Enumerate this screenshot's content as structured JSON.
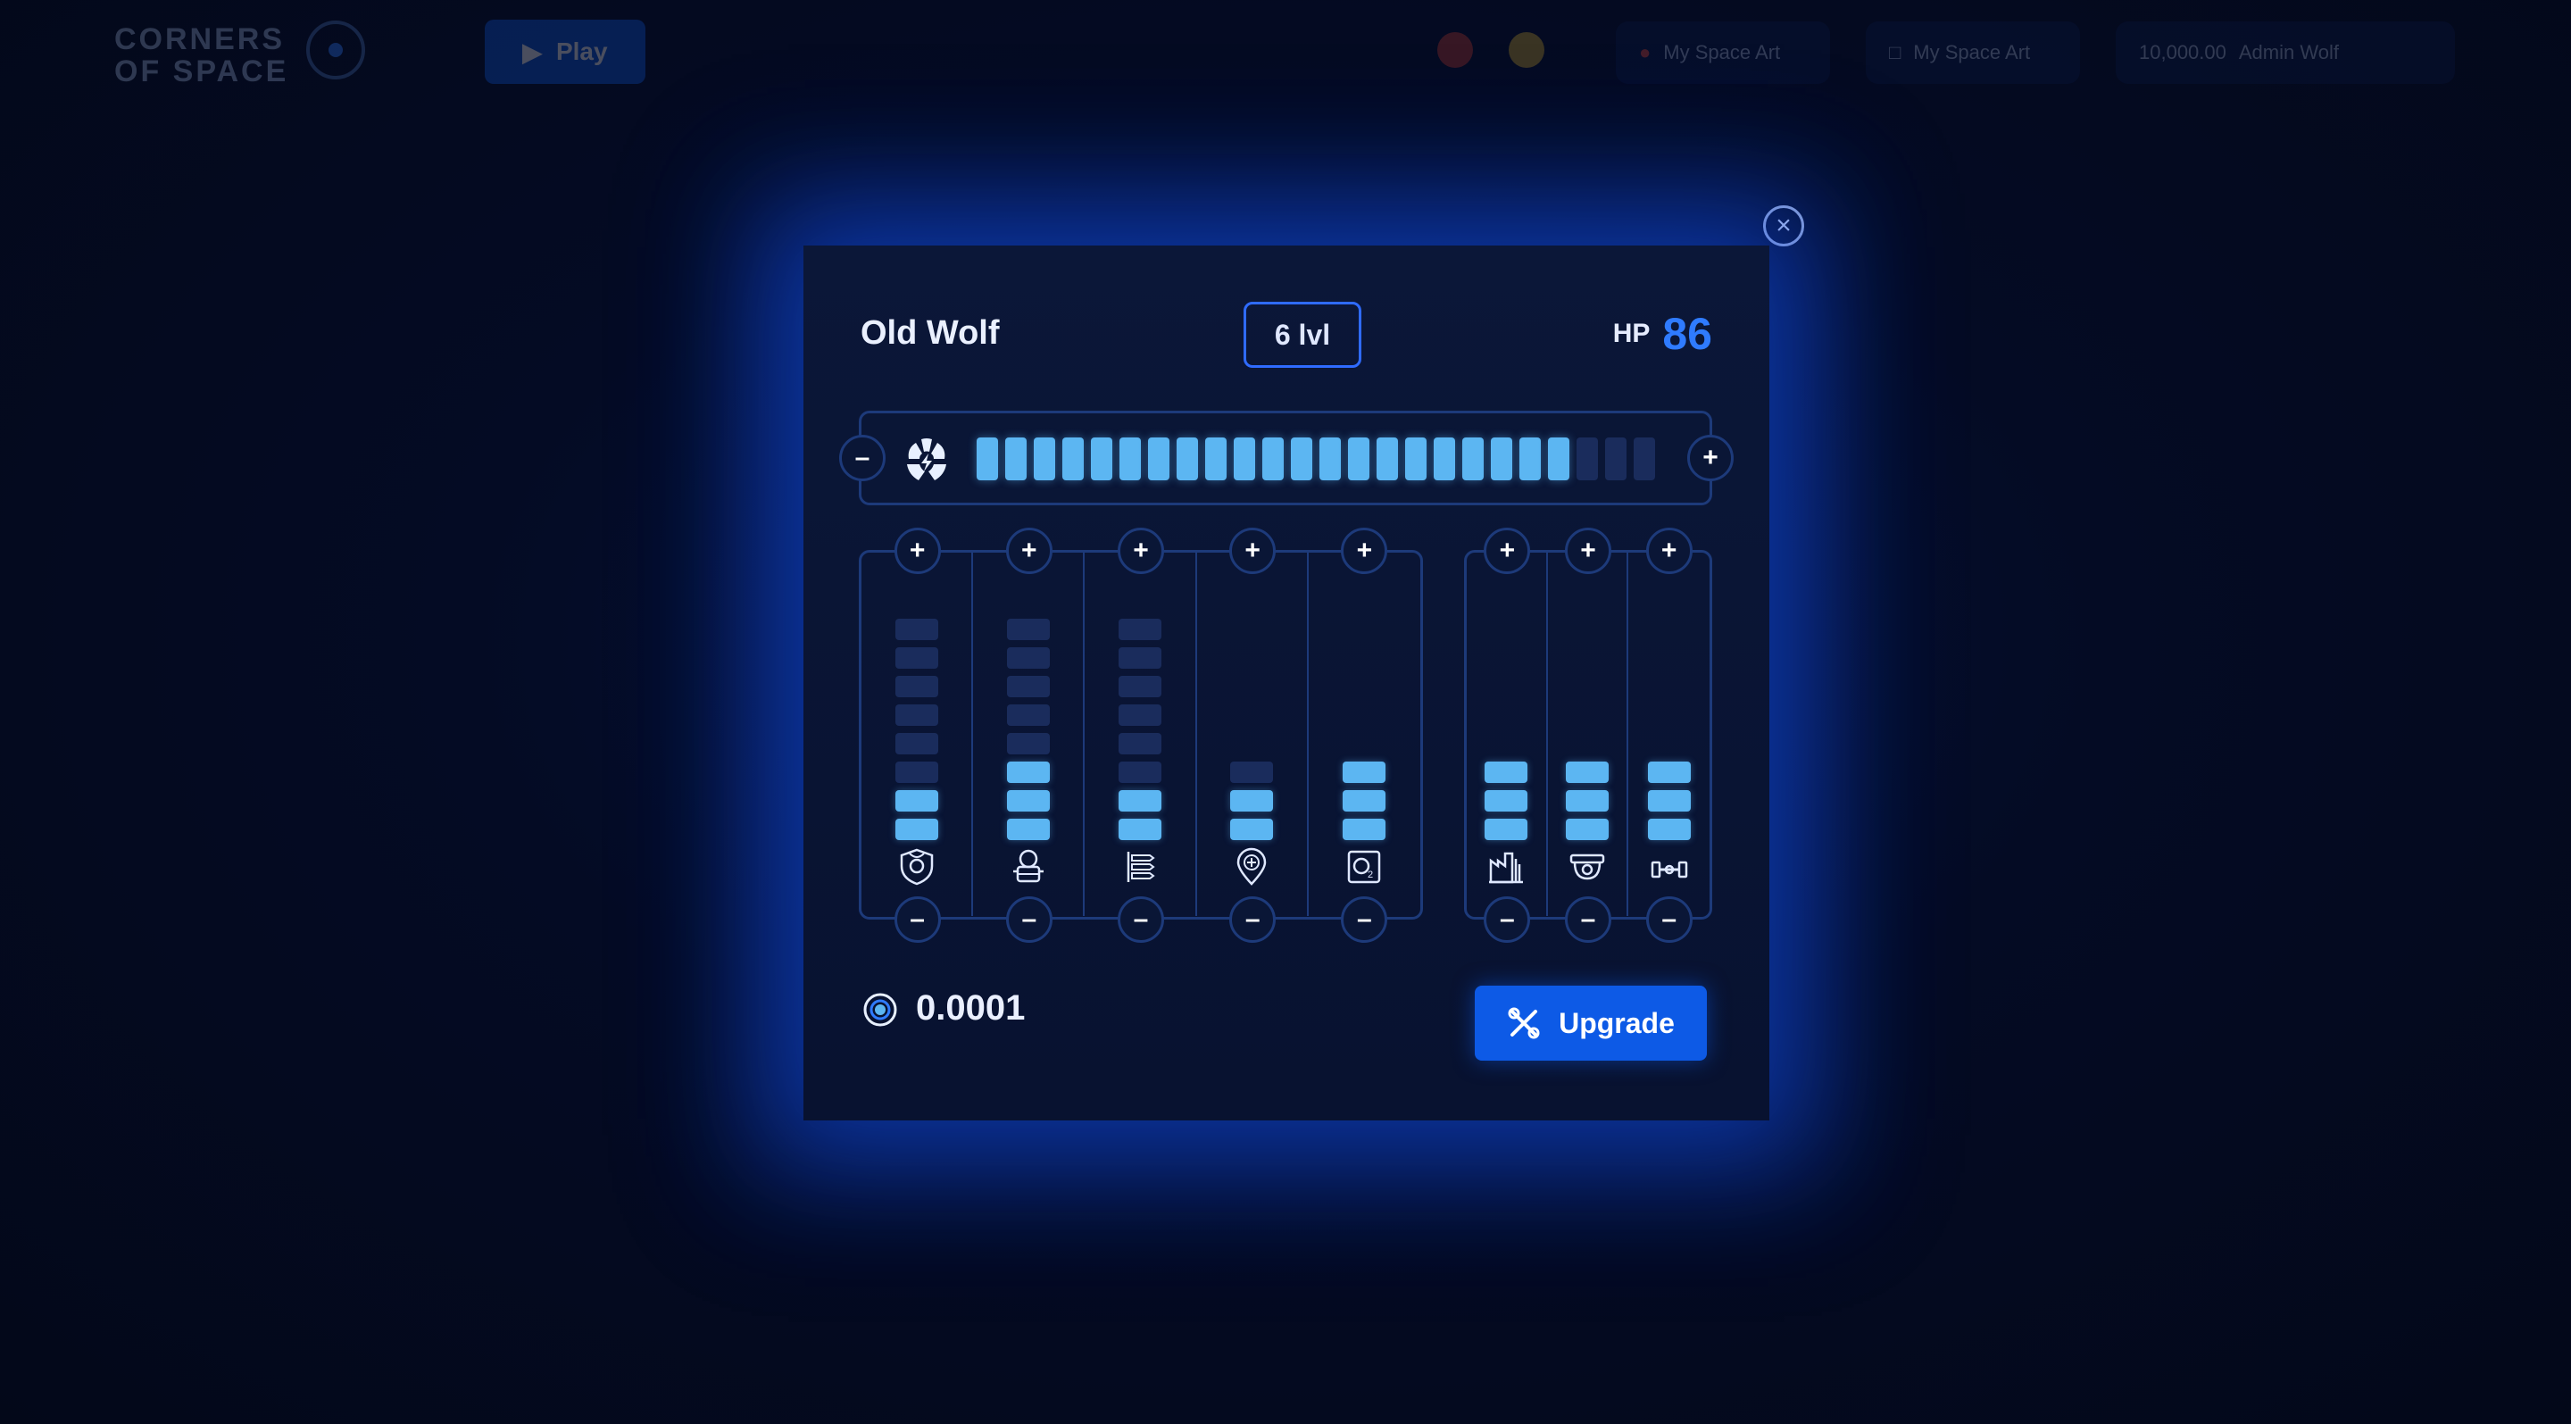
{
  "header": {
    "logo_line1": "CORNERS",
    "logo_line2": "OF SPACE",
    "play_label": "Play",
    "pill1_text": "My Space Art",
    "pill2_text": "My Space Art",
    "wallet_amount": "10,000.00",
    "wallet_user": "Admin Wolf"
  },
  "modal": {
    "ship_name": "Old Wolf",
    "level": "6 lvl",
    "hp_label": "HP",
    "hp_value": "86",
    "energy": {
      "icon": "radiation-bolt-icon",
      "filled": 21,
      "total": 24
    },
    "systems_left": [
      {
        "name": "shield",
        "icon": "shield-icon",
        "filled": 2,
        "total": 8
      },
      {
        "name": "robot",
        "icon": "robot-icon",
        "filled": 3,
        "total": 8
      },
      {
        "name": "ammo",
        "icon": "ammo-rack-icon",
        "filled": 2,
        "total": 8
      },
      {
        "name": "repair",
        "icon": "location-plus-icon",
        "filled": 2,
        "total": 3
      },
      {
        "name": "oxygen",
        "icon": "oxygen-icon",
        "filled": 3,
        "total": 3
      }
    ],
    "systems_right": [
      {
        "name": "factory",
        "icon": "factory-icon",
        "filled": 3,
        "total": 3
      },
      {
        "name": "camera",
        "icon": "camera-icon",
        "filled": 3,
        "total": 3
      },
      {
        "name": "cannon",
        "icon": "cannon-icon",
        "filled": 3,
        "total": 3
      }
    ],
    "balance": "0.0001",
    "upgrade_label": "Upgrade"
  },
  "colors": {
    "accent": "#2f7bff",
    "button": "#0d5ae6",
    "bar_on": "#5cb6f2",
    "bar_off": "#1a2c5c",
    "border": "#1d3a7a"
  }
}
